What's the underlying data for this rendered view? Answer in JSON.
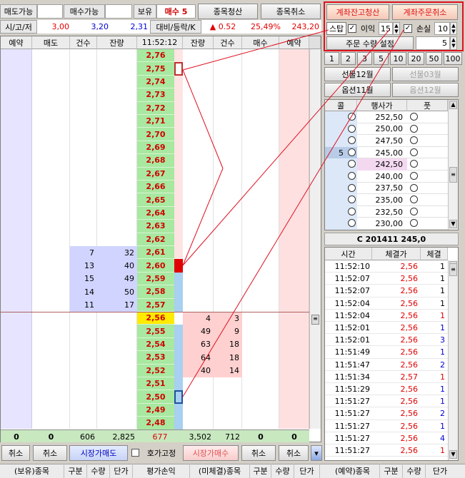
{
  "top": {
    "sell_avail_label": "매도가능",
    "sell_avail_value": "",
    "buy_avail_label": "매수가능",
    "buy_avail_value": "",
    "holding_label": "보유",
    "holding_value": "매수 5",
    "close_item_btn": "종목청산",
    "cancel_item_btn": "종목취소",
    "acct_close_btn": "계좌잔고청산",
    "acct_cancel_btn": "계좌주문취소"
  },
  "ohlc": {
    "label": "시/고/저",
    "open": "3,00",
    "high": "3,20",
    "low": "2,31",
    "change_label": "대비/등락/K",
    "change": "▲ 0.52",
    "rate": "25,49%",
    "k": "243,20"
  },
  "stop": {
    "label": "스탑",
    "profit_label": "이익",
    "profit_value": "15",
    "loss_label": "손실",
    "loss_value": "10",
    "qty_btn": "주문 수량 설정",
    "qty_value": "5"
  },
  "headers": {
    "res1": "예약",
    "sell": "매도",
    "cnt1": "건수",
    "rem1": "잔량",
    "time": "11:52:12",
    "rem2": "잔량",
    "cnt2": "건수",
    "buy": "매수",
    "res2": "예약"
  },
  "prices": [
    "2,76",
    "2,75",
    "2,74",
    "2,73",
    "2,72",
    "2,71",
    "2,70",
    "2,69",
    "2,68",
    "2,67",
    "2,66",
    "2,65",
    "2,64",
    "2,63",
    "2,62",
    "2,61",
    "2,60",
    "2,59",
    "2,58",
    "2,57",
    "2,56",
    "2,55",
    "2,54",
    "2,53",
    "2,52",
    "2,51",
    "2,50",
    "2,49",
    "2,48"
  ],
  "ask_book": [
    {
      "cnt": "7",
      "qty": "32"
    },
    {
      "cnt": "13",
      "qty": "40"
    },
    {
      "cnt": "15",
      "qty": "49"
    },
    {
      "cnt": "14",
      "qty": "50"
    },
    {
      "cnt": "11",
      "qty": "17"
    }
  ],
  "bid_book": [
    {
      "qty": "4",
      "cnt": "3"
    },
    {
      "qty": "49",
      "cnt": "9"
    },
    {
      "qty": "63",
      "cnt": "18"
    },
    {
      "qty": "64",
      "cnt": "18"
    },
    {
      "qty": "40",
      "cnt": "14"
    }
  ],
  "totals": {
    "res1": "0",
    "sell": "0",
    "cnt1": "606",
    "rem1": "2,825",
    "center": "677",
    "rem2": "3,502",
    "cnt2": "712",
    "buy": "0",
    "res2": "0"
  },
  "bottom": {
    "cancel1": "취소",
    "cancel2": "취소",
    "market_sell": "시장가매도",
    "fix_price": "호가고정",
    "market_buy": "시장가매수",
    "cancel3": "취소",
    "cancel4": "취소"
  },
  "tabs": {
    "holding": "(보유)종목",
    "pos_hdr": [
      "구분",
      "수량",
      "단가"
    ],
    "pnl": "평가손익",
    "unfilled": "(미체결)종목",
    "unf_hdr": [
      "구분",
      "수량",
      "단가"
    ],
    "reserved": "(예약)종목",
    "res_hdr": [
      "구분",
      "수량",
      "단가"
    ]
  },
  "qty_buttons": [
    "1",
    "2",
    "3",
    "5",
    "10",
    "20",
    "50",
    "100"
  ],
  "futures": {
    "f1": "선물12월",
    "f2": "선물03월",
    "o1": "옵션11월",
    "o2": "옵션12월"
  },
  "opt_headers": {
    "call": "콜",
    "strike": "행사가",
    "put": "풋"
  },
  "options": [
    {
      "call": "",
      "strike": "252,50"
    },
    {
      "call": "",
      "strike": "250,00"
    },
    {
      "call": "",
      "strike": "247,50"
    },
    {
      "call": "5",
      "strike": "245,00"
    },
    {
      "call": "",
      "strike": "242,50"
    },
    {
      "call": "",
      "strike": "240,00"
    },
    {
      "call": "",
      "strike": "237,50"
    },
    {
      "call": "",
      "strike": "235,00"
    },
    {
      "call": "",
      "strike": "232,50"
    },
    {
      "call": "",
      "strike": "230,00"
    }
  ],
  "contract_title": "C 201411 245,0",
  "trade_headers": {
    "time": "시간",
    "price": "체결가",
    "qty": "체결"
  },
  "trades": [
    {
      "t": "11:52:10",
      "p": "2,56",
      "q": "1",
      "c": "k"
    },
    {
      "t": "11:52:07",
      "p": "2,56",
      "q": "1",
      "c": "k"
    },
    {
      "t": "11:52:07",
      "p": "2,56",
      "q": "1",
      "c": "k"
    },
    {
      "t": "11:52:04",
      "p": "2,56",
      "q": "1",
      "c": "k"
    },
    {
      "t": "11:52:04",
      "p": "2,56",
      "q": "1",
      "c": "r"
    },
    {
      "t": "11:52:01",
      "p": "2,56",
      "q": "1",
      "c": "b"
    },
    {
      "t": "11:52:01",
      "p": "2,56",
      "q": "3",
      "c": "b"
    },
    {
      "t": "11:51:49",
      "p": "2,56",
      "q": "1",
      "c": "b"
    },
    {
      "t": "11:51:47",
      "p": "2,56",
      "q": "2",
      "c": "b"
    },
    {
      "t": "11:51:34",
      "p": "2,57",
      "q": "1",
      "c": "r"
    },
    {
      "t": "11:51:29",
      "p": "2,56",
      "q": "1",
      "c": "b"
    },
    {
      "t": "11:51:27",
      "p": "2,56",
      "q": "1",
      "c": "b"
    },
    {
      "t": "11:51:27",
      "p": "2,56",
      "q": "2",
      "c": "b"
    },
    {
      "t": "11:51:27",
      "p": "2,56",
      "q": "1",
      "c": "b"
    },
    {
      "t": "11:51:27",
      "p": "2,56",
      "q": "4",
      "c": "b"
    },
    {
      "t": "11:51:27",
      "p": "2,56",
      "q": "1",
      "c": "r"
    }
  ]
}
